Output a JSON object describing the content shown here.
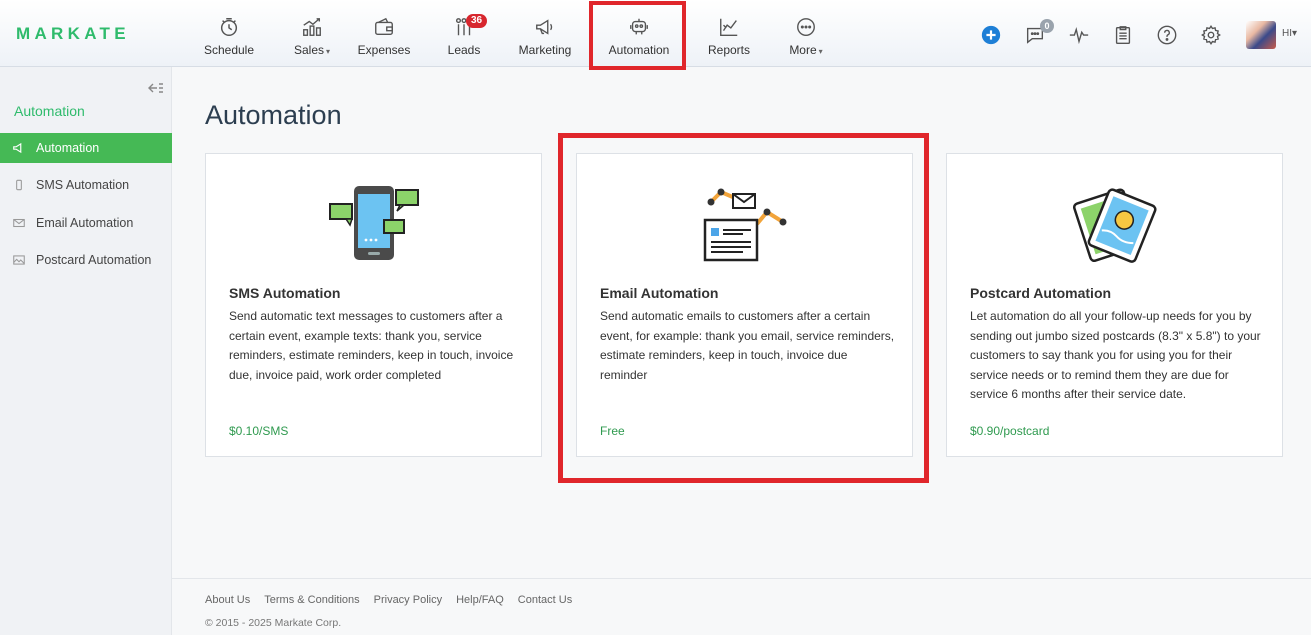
{
  "brand": {
    "name": "MARKATE",
    "color": "#2fbb6c"
  },
  "nav": {
    "items": [
      {
        "label": "Schedule",
        "icon": "clock-icon"
      },
      {
        "label": "Sales",
        "icon": "chart-up-icon",
        "has_caret": true
      },
      {
        "label": "Expenses",
        "icon": "wallet-icon"
      },
      {
        "label": "Leads",
        "icon": "funnel-icon",
        "badge": "36"
      },
      {
        "label": "Marketing",
        "icon": "megaphone-icon"
      },
      {
        "label": "Automation",
        "icon": "robot-icon",
        "active": true
      },
      {
        "label": "Reports",
        "icon": "line-chart-icon"
      },
      {
        "label": "More",
        "icon": "dots-icon",
        "has_caret": true
      }
    ],
    "caret": "▾"
  },
  "header_right": {
    "messages_badge": "0",
    "user_initials": "HI",
    "caret": "▾"
  },
  "sidebar": {
    "title": "Automation",
    "items": [
      {
        "label": "Automation",
        "icon": "megaphone-icon",
        "active": true
      },
      {
        "label": "SMS Automation",
        "icon": "phone-icon"
      },
      {
        "label": "Email Automation",
        "icon": "envelope-icon"
      },
      {
        "label": "Postcard Automation",
        "icon": "image-icon"
      }
    ]
  },
  "main": {
    "title": "Automation",
    "cards": [
      {
        "title": "SMS Automation",
        "description": "Send automatic text messages to customers after a certain event, example texts: thank you, service reminders, estimate reminders, keep in touch, invoice due, invoice paid, work order completed",
        "price": "$0.10/SMS",
        "icon": "smartphone-chat-icon"
      },
      {
        "title": "Email Automation",
        "description": "Send automatic emails to customers after a certain event, for example: thank you email, service reminders, estimate reminders, keep in touch, invoice due reminder",
        "price": "Free",
        "icon": "email-robot-arm-icon"
      },
      {
        "title": "Postcard Automation",
        "description": "Let automation do all your follow-up needs for you by sending out jumbo sized postcards (8.3\" x 5.8\") to your customers to say thank you for using you for their service needs or to remind them they are due for service 6 months after their service date.",
        "price": "$0.90/postcard",
        "icon": "postcards-icon"
      }
    ]
  },
  "footer": {
    "links": [
      "About Us",
      "Terms & Conditions",
      "Privacy Policy",
      "Help/FAQ",
      "Contact Us"
    ],
    "copyright": "© 2015 - 2025 Markate Corp."
  },
  "colors": {
    "accent_green": "#45b955",
    "highlight_red": "#e0262b",
    "badge_red": "#d7262e",
    "price_green": "#2f9a4f"
  }
}
